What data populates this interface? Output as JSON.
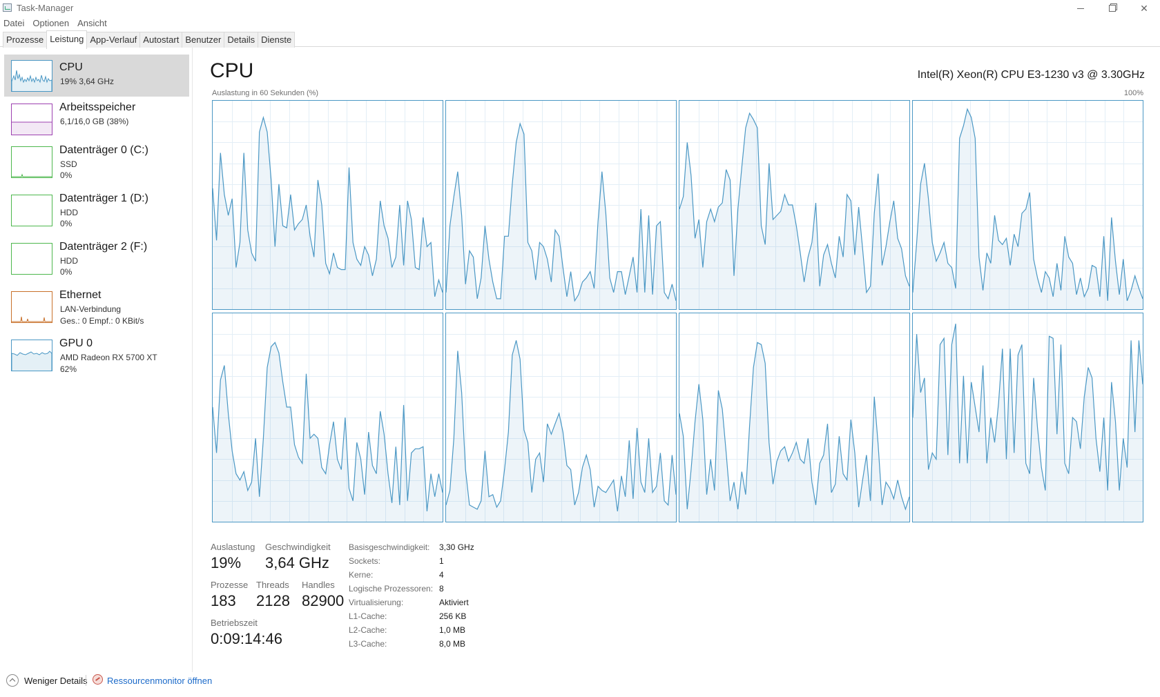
{
  "window": {
    "title": "Task-Manager",
    "app_icon": "task-manager-icon"
  },
  "menu": [
    "Datei",
    "Optionen",
    "Ansicht"
  ],
  "tabs": [
    "Prozesse",
    "Leistung",
    "App-Verlauf",
    "Autostart",
    "Benutzer",
    "Details",
    "Dienste"
  ],
  "active_tab": "Leistung",
  "sidebar": [
    {
      "name": "CPU",
      "sub1": "19%  3,64 GHz",
      "sub2": "",
      "color": "#4a97c4",
      "selected": true
    },
    {
      "name": "Arbeitsspeicher",
      "sub1": "6,1/16,0 GB (38%)",
      "sub2": "",
      "color": "#9c3fb0",
      "selected": false
    },
    {
      "name": "Datenträger 0 (C:)",
      "sub1": "SSD",
      "sub2": "0%",
      "color": "#4cb74c",
      "selected": false
    },
    {
      "name": "Datenträger 1 (D:)",
      "sub1": "HDD",
      "sub2": "0%",
      "color": "#4cb74c",
      "selected": false
    },
    {
      "name": "Datenträger 2 (F:)",
      "sub1": "HDD",
      "sub2": "0%",
      "color": "#4cb74c",
      "selected": false
    },
    {
      "name": "Ethernet",
      "sub1": "LAN-Verbindung",
      "sub2": "Ges.: 0  Empf.: 0 KBit/s",
      "color": "#c8702a",
      "selected": false
    },
    {
      "name": "GPU 0",
      "sub1": "AMD Radeon RX 5700 XT",
      "sub2": "62%",
      "color": "#4a97c4",
      "selected": false
    }
  ],
  "main": {
    "title": "CPU",
    "cpu_model": "Intel(R) Xeon(R) CPU E3-1230 v3 @ 3.30GHz",
    "graph_caption": "Auslastung in 60 Sekunden (%)",
    "graph_max": "100%",
    "graph_color": "#4a97c4"
  },
  "stats": {
    "auslastung_label": "Auslastung",
    "auslastung": "19%",
    "geschwindigkeit_label": "Geschwindigkeit",
    "geschwindigkeit": "3,64 GHz",
    "prozesse_label": "Prozesse",
    "prozesse": "183",
    "threads_label": "Threads",
    "threads": "2128",
    "handles_label": "Handles",
    "handles": "82900",
    "betriebszeit_label": "Betriebszeit",
    "betriebszeit": "0:09:14:46"
  },
  "properties": [
    {
      "label": "Basisgeschwindigkeit:",
      "value": "3,30 GHz"
    },
    {
      "label": "Sockets:",
      "value": "1"
    },
    {
      "label": "Kerne:",
      "value": "4"
    },
    {
      "label": "Logische Prozessoren:",
      "value": "8"
    },
    {
      "label": "Virtualisierung:",
      "value": "Aktiviert"
    },
    {
      "label": "L1-Cache:",
      "value": "256 KB"
    },
    {
      "label": "L2-Cache:",
      "value": "1,0 MB"
    },
    {
      "label": "L3-Cache:",
      "value": "8,0 MB"
    }
  ],
  "footer": {
    "fewer_details": "Weniger Details",
    "resource_monitor": "Ressourcenmonitor öffnen"
  },
  "chart_data": {
    "type": "line",
    "title": "Auslastung in 60 Sekunden (%)",
    "ylim": [
      0,
      100
    ],
    "x_count": 60,
    "series": [
      {
        "values": [
          58,
          33,
          75,
          55,
          45,
          53,
          20,
          32,
          75,
          38,
          27,
          23,
          85,
          92,
          85,
          62,
          30,
          60,
          40,
          39,
          55,
          38,
          41,
          43,
          50,
          35,
          25,
          62,
          50,
          22,
          17,
          27,
          20,
          19,
          19,
          68,
          32,
          24,
          21,
          30,
          26,
          16,
          24,
          52,
          40,
          34,
          20,
          25,
          50,
          21,
          52,
          43,
          20,
          19,
          44,
          30,
          32,
          6,
          14,
          8
        ]
      },
      {
        "values": [
          8,
          40,
          54,
          66,
          45,
          12,
          28,
          25,
          5,
          15,
          40,
          24,
          13,
          5,
          5,
          35,
          35,
          60,
          80,
          89,
          84,
          32,
          28,
          14,
          32,
          30,
          24,
          13,
          38,
          35,
          20,
          6,
          18,
          4,
          7,
          13,
          15,
          18,
          10,
          42,
          66,
          46,
          15,
          8,
          18,
          18,
          7,
          16,
          25,
          8,
          48,
          8,
          45,
          7,
          40,
          42,
          8,
          5,
          12,
          4
        ]
      },
      {
        "values": [
          48,
          54,
          80,
          64,
          34,
          43,
          20,
          42,
          48,
          42,
          49,
          51,
          67,
          62,
          16,
          48,
          68,
          87,
          94,
          91,
          87,
          40,
          31,
          70,
          43,
          45,
          47,
          55,
          50,
          50,
          40,
          27,
          13,
          25,
          32,
          51,
          11,
          26,
          31,
          22,
          15,
          35,
          25,
          55,
          52,
          26,
          49,
          29,
          8,
          11,
          46,
          65,
          21,
          30,
          42,
          52,
          34,
          29,
          16,
          11
        ]
      },
      {
        "values": [
          8,
          32,
          60,
          70,
          53,
          32,
          23,
          27,
          32,
          22,
          20,
          10,
          82,
          88,
          96,
          92,
          82,
          25,
          9,
          27,
          22,
          45,
          33,
          31,
          34,
          21,
          36,
          30,
          46,
          48,
          56,
          24,
          15,
          8,
          18,
          15,
          6,
          22,
          9,
          35,
          25,
          22,
          7,
          15,
          6,
          10,
          21,
          20,
          6,
          35,
          4,
          44,
          23,
          7,
          24,
          4,
          9,
          16,
          10,
          5
        ]
      },
      {
        "values": [
          55,
          33,
          68,
          75,
          52,
          34,
          23,
          20,
          24,
          15,
          19,
          40,
          12,
          40,
          74,
          84,
          86,
          81,
          67,
          55,
          55,
          37,
          31,
          28,
          71,
          40,
          42,
          40,
          26,
          23,
          37,
          48,
          30,
          25,
          50,
          16,
          10,
          38,
          30,
          13,
          43,
          27,
          23,
          53,
          42,
          23,
          9,
          36,
          8,
          56,
          10,
          33,
          35,
          35,
          36,
          5,
          23,
          12,
          23,
          14
        ]
      },
      {
        "values": [
          8,
          15,
          40,
          82,
          62,
          25,
          8,
          7,
          6,
          10,
          34,
          12,
          13,
          7,
          10,
          25,
          43,
          80,
          87,
          78,
          44,
          38,
          14,
          30,
          33,
          19,
          47,
          42,
          47,
          52,
          43,
          27,
          25,
          8,
          14,
          26,
          32,
          25,
          7,
          17,
          15,
          14,
          17,
          20,
          5,
          22,
          12,
          39,
          11,
          45,
          19,
          14,
          40,
          14,
          17,
          33,
          10,
          8,
          32,
          13
        ]
      },
      {
        "values": [
          52,
          41,
          6,
          25,
          48,
          66,
          49,
          13,
          30,
          15,
          63,
          54,
          33,
          10,
          19,
          6,
          24,
          13,
          46,
          74,
          86,
          85,
          76,
          38,
          18,
          29,
          34,
          36,
          29,
          33,
          38,
          30,
          28,
          40,
          19,
          8,
          28,
          32,
          47,
          14,
          18,
          41,
          23,
          20,
          49,
          33,
          7,
          20,
          32,
          10,
          60,
          37,
          8,
          19,
          16,
          11,
          20,
          12,
          6,
          12
        ]
      },
      {
        "values": [
          50,
          90,
          62,
          69,
          25,
          33,
          30,
          85,
          88,
          32,
          85,
          95,
          28,
          70,
          28,
          67,
          55,
          43,
          75,
          28,
          50,
          38,
          57,
          83,
          30,
          83,
          33,
          80,
          85,
          28,
          23,
          69,
          45,
          26,
          15,
          89,
          88,
          42,
          85,
          28,
          23,
          50,
          48,
          35,
          60,
          74,
          69,
          40,
          24,
          50,
          15,
          67,
          48,
          15,
          40,
          26,
          87,
          43,
          87,
          66
        ]
      }
    ]
  }
}
